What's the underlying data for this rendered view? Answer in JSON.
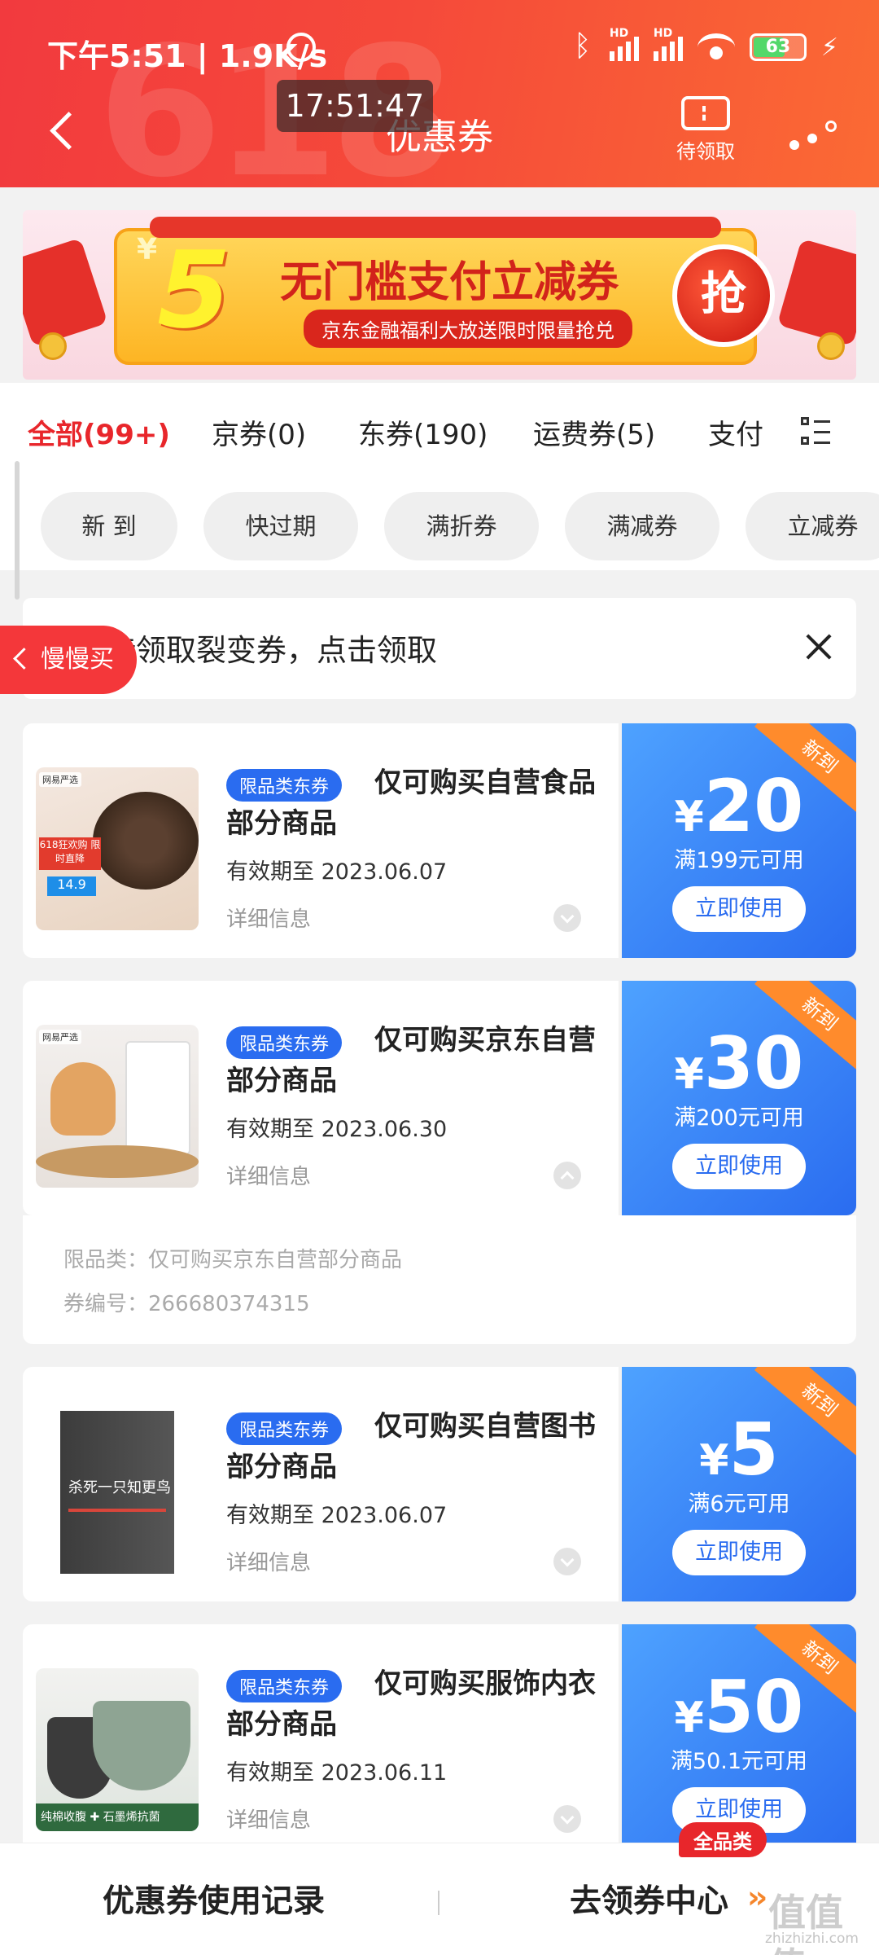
{
  "status_bar": {
    "time": "下午5:51 | 1.9K/s",
    "signal_1": "HD",
    "signal_2": "HD",
    "battery": "63"
  },
  "clock_overlay": "17:51:47",
  "header": {
    "title": "优惠券",
    "ticket_label": "待领取",
    "ghost_text": "618"
  },
  "banner": {
    "currency": "¥",
    "amount": "5",
    "main_text": "无门槛支付立减券",
    "sub_text": "京东金融福利大放送限时限量抢兑",
    "grab_label": "抢"
  },
  "tabs": [
    {
      "label": "全部(99+)",
      "active": true
    },
    {
      "label": "京券(0)"
    },
    {
      "label": "东券(190)"
    },
    {
      "label": "运费券(5)"
    },
    {
      "label": "支付"
    }
  ],
  "chips": [
    "新 到",
    "快过期",
    "满折券",
    "满减券",
    "立减券"
  ],
  "notice": {
    "text": "你有待领取裂变券，点击领取",
    "floating_label": "慢慢买"
  },
  "coupons": [
    {
      "tag": "限品类东券",
      "title": "仅可购买自营食品部分商品",
      "valid": "有效期至 2023.06.07",
      "detail": "详细信息",
      "currency": "¥",
      "value": "20",
      "condition": "满199元可用",
      "use_label": "立即使用",
      "ribbon": "新到",
      "thumb_brand": "网易严选",
      "thumb_badge": "618狂欢购 限时直降",
      "thumb_price": "14.9"
    },
    {
      "tag": "限品类东券",
      "title": "仅可购买京东自营部分商品",
      "valid": "有效期至 2023.06.30",
      "detail": "详细信息",
      "currency": "¥",
      "value": "30",
      "condition": "满200元可用",
      "use_label": "立即使用",
      "ribbon": "新到",
      "thumb_brand": "网易严选"
    },
    {
      "tag": "限品类东券",
      "title": "仅可购买自营图书部分商品",
      "valid": "有效期至 2023.06.07",
      "detail": "详细信息",
      "currency": "¥",
      "value": "5",
      "condition": "满6元可用",
      "use_label": "立即使用",
      "ribbon": "新到",
      "thumb_title": "杀死一只知更鸟"
    },
    {
      "tag": "限品类东券",
      "title": "仅可购买服饰内衣部分商品",
      "valid": "有效期至 2023.06.11",
      "detail": "详细信息",
      "currency": "¥",
      "value": "50",
      "condition": "满50.1元可用",
      "use_label": "立即使用",
      "ribbon": "新到",
      "thumb_band": "纯棉收腹 ✚ 石墨烯抗菌"
    }
  ],
  "expanded_details": {
    "category": "限品类：仅可购买京东自营部分商品",
    "number": "券编号：266680374315"
  },
  "bottom_bar": {
    "records": "优惠券使用记录",
    "center": "去领券中心",
    "badge": "全品类"
  },
  "watermark": {
    "main": "值值值",
    "site": "zhizhizhi.com"
  }
}
